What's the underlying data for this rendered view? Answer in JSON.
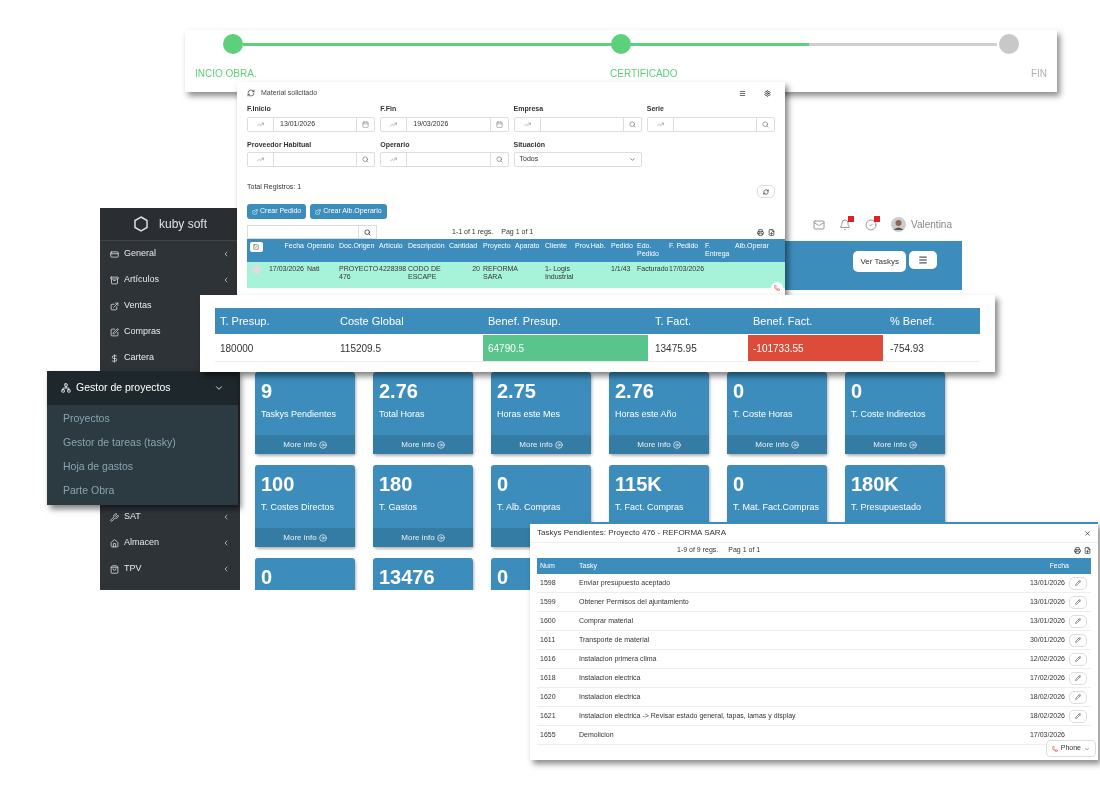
{
  "stepper": {
    "level": 0.75,
    "steps": [
      {
        "label": "INCIO OBRA.",
        "done": true
      },
      {
        "label": "CERTIFICADO",
        "done": true
      },
      {
        "label": "FIN",
        "done": false
      }
    ]
  },
  "dashboard": {
    "brand": "kuby soft",
    "user": "Valentina",
    "ver_taskys": "Ver Taskys",
    "sidebar_top": [
      {
        "label": "General",
        "has_submenu": true
      },
      {
        "label": "Artículos",
        "has_submenu": true
      },
      {
        "label": "Ventas",
        "has_submenu": false
      },
      {
        "label": "Compras",
        "has_submenu": false
      },
      {
        "label": "Cartera",
        "has_submenu": false
      }
    ],
    "sidebar_bottom": [
      {
        "label": "SAT",
        "has_submenu": true
      },
      {
        "label": "Almacen",
        "has_submenu": true
      },
      {
        "label": "TPV",
        "has_submenu": true
      }
    ],
    "tiles": [
      {
        "value": "9",
        "label": "Taskys Pendientes",
        "footer": "More info"
      },
      {
        "value": "2.76",
        "label": "Total Horas",
        "footer": "More info"
      },
      {
        "value": "2.75",
        "label": "Horas este Mes",
        "footer": "More info"
      },
      {
        "value": "2.76",
        "label": "Horas este Año",
        "footer": "More info"
      },
      {
        "value": "0",
        "label": "T. Coste Horas",
        "footer": "More info"
      },
      {
        "value": "0",
        "label": "T. Coste Indirectos",
        "footer": "More info"
      },
      {
        "value": "100",
        "label": "T. Costes Directos",
        "footer": "More info"
      },
      {
        "value": "180",
        "label": "T. Gastos",
        "footer": "More info"
      },
      {
        "value": "0",
        "label": "T. Alb. Compras",
        "footer_bar": true
      },
      {
        "value": "115K",
        "label": "T. Fact. Compras"
      },
      {
        "value": "0",
        "label": "T. Mat. Fact.Compras"
      },
      {
        "value": "180K",
        "label": "T. Presupuestado"
      },
      {
        "value": "0"
      },
      {
        "value": "13476"
      },
      {
        "value": "0"
      }
    ]
  },
  "menu_popup": {
    "title": "Gestor de proyectos",
    "expanded": true,
    "children": [
      "Proyectos",
      "Gestor de tareas (tasky)",
      "Hoja de gastos",
      "Parte Obra"
    ]
  },
  "filter_panel": {
    "title": "Material solicitado",
    "fields": [
      {
        "label": "F.Inicio",
        "kind": "date",
        "value": "13/01/2026"
      },
      {
        "label": "F.Fin",
        "kind": "date",
        "value": "19/03/2026"
      },
      {
        "label": "Empresa",
        "kind": "lookup"
      },
      {
        "label": "Serie",
        "kind": "lookup"
      },
      {
        "label": "Proveedor Habitual",
        "kind": "lookup"
      },
      {
        "label": "Operario",
        "kind": "lookup"
      },
      {
        "label": "Situación",
        "kind": "select",
        "value": "Todos"
      }
    ],
    "total": "Total Registros: 1",
    "buttons": [
      "Crear Pedido",
      "Crear Alb.Operario"
    ],
    "pager": "1-1 of 1 regs.",
    "page": "Pag 1 of 1",
    "columns": [
      "Fecha",
      "Operario",
      "Doc.Origen",
      "Artículo",
      "Descripción",
      "Cantidad",
      "Proyecto",
      "Aparato",
      "Cliente",
      "Prov.Hab.",
      "Pedido",
      "Edo. Pedido",
      "F. Pedido",
      "F. Entrega",
      "Alb.Operar"
    ],
    "rows": [
      {
        "selected": true,
        "cells": [
          "17/03/2026",
          "Nati",
          "PROYECTO 476",
          "4228398",
          "CODO DE ESCAPE",
          "20",
          "REFORMA SARA",
          "",
          "1- Logis Industrial",
          "",
          "1/1/43",
          "Facturado",
          "17/03/2026",
          "",
          ""
        ]
      }
    ]
  },
  "totals": {
    "columns": [
      "T. Presup.",
      "Coste Global",
      "Benef. Presup.",
      "T. Fact.",
      "Benef. Fact.",
      "% Benef."
    ],
    "values": [
      {
        "text": "180000"
      },
      {
        "text": "115209.5"
      },
      {
        "text": "64790.5",
        "color": "#5ac48d"
      },
      {
        "text": "13475.95"
      },
      {
        "text": "-101733.55",
        "color": "#dd4b39"
      },
      {
        "text": "-754.93"
      }
    ]
  },
  "taskys_modal": {
    "title": "Taskys Pendientes: Proyecto 476 - REFORMA SARA",
    "pager": "1-9 of 9 regs.",
    "page": "Pag 1 of 1",
    "columns": [
      "Num",
      "Tasky",
      "Fecha"
    ],
    "rows": [
      [
        "1598",
        "Enviar presupuesto aceptado",
        "13/01/2026"
      ],
      [
        "1599",
        "Obtener Permisos del ajuntamiento",
        "13/01/2026"
      ],
      [
        "1600",
        "Comprar material",
        "13/01/2026"
      ],
      [
        "1611",
        "Transporte de material",
        "30/01/2026"
      ],
      [
        "1616",
        "Instalacion primera clima",
        "12/02/2026"
      ],
      [
        "1618",
        "Instalacion electrica",
        "17/02/2026"
      ],
      [
        "1620",
        "Instalacion electrica",
        "18/02/2026"
      ],
      [
        "1621",
        "Instalacion electrica -> Revisar estado general, tapas, lamas y display",
        "18/02/2026"
      ],
      [
        "1655",
        "Demolicion",
        "17/03/2026"
      ]
    ],
    "phone": "Phone"
  }
}
